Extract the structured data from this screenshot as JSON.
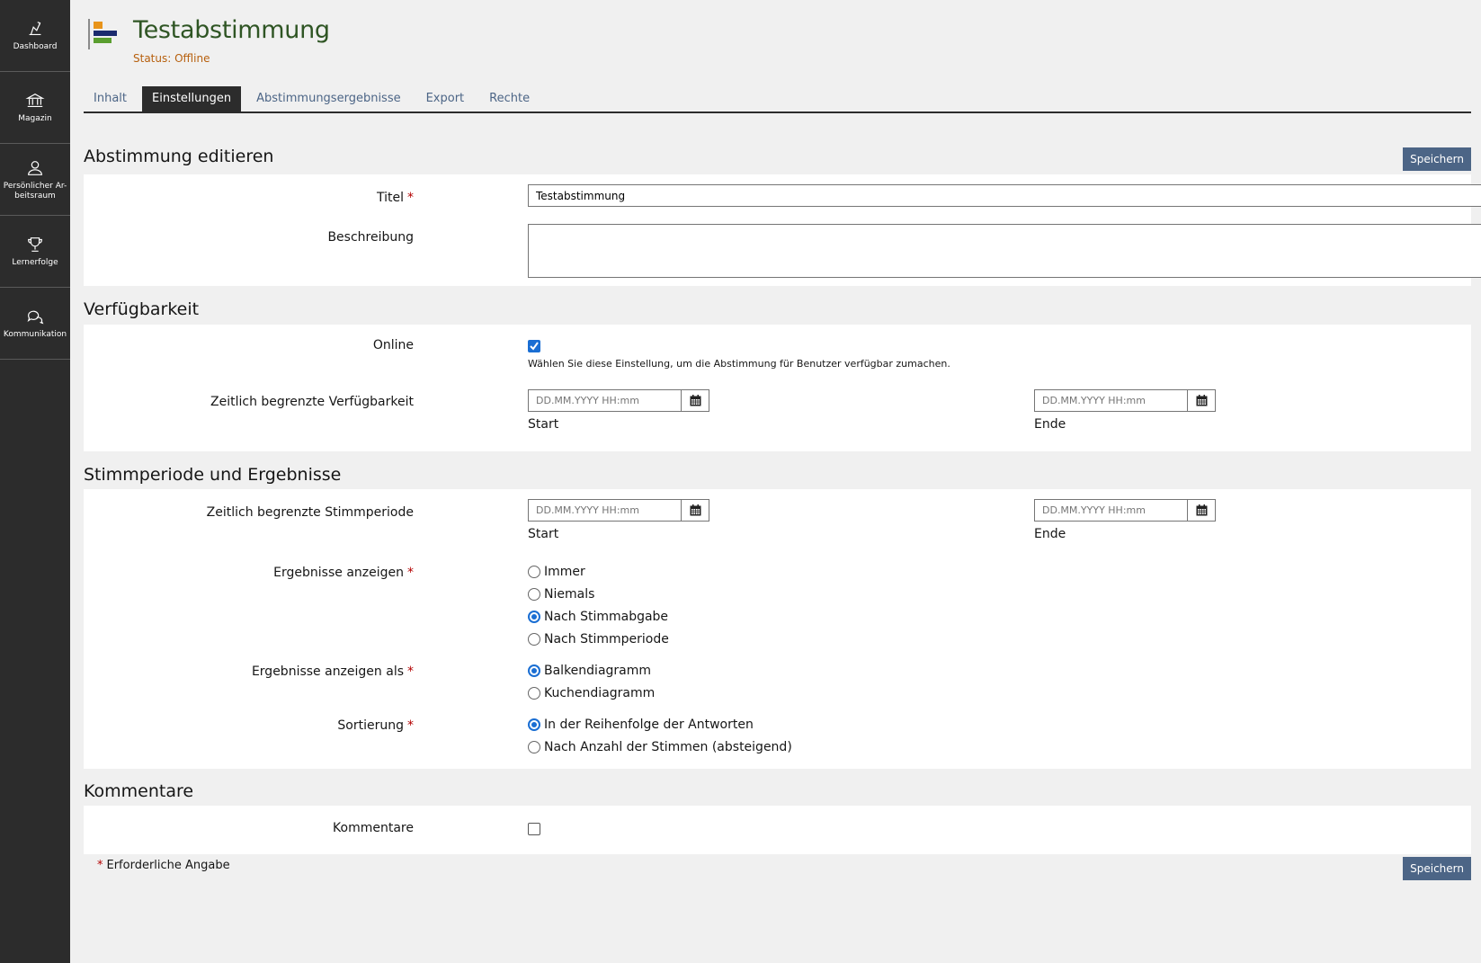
{
  "sidebar": {
    "items": [
      {
        "label": "Dashboard",
        "icon": "dashboard-icon"
      },
      {
        "label": "Magazin",
        "icon": "bank-icon"
      },
      {
        "label": "Persönlicher Ar-beitsraum",
        "icon": "user-icon"
      },
      {
        "label": "Lernerfolge",
        "icon": "trophy-icon"
      },
      {
        "label": "Kommunikation",
        "icon": "chat-icon"
      }
    ]
  },
  "header": {
    "title": "Testabstimmung",
    "status": "Status: Offline",
    "icon": "poll-icon",
    "icon_colors": [
      "#e8941a",
      "#1b2b6e",
      "#5a9e2f"
    ]
  },
  "tabs": [
    {
      "label": "Inhalt",
      "active": false
    },
    {
      "label": "Einstellungen",
      "active": true
    },
    {
      "label": "Abstimmungsergebnisse",
      "active": false
    },
    {
      "label": "Export",
      "active": false
    },
    {
      "label": "Rechte",
      "active": false
    }
  ],
  "form": {
    "save_label": "Speichern",
    "edit": {
      "title": "Abstimmung editieren",
      "titel_label": "Titel",
      "titel_value": "Testabstimmung",
      "beschreibung_label": "Beschreibung",
      "beschreibung_value": ""
    },
    "availability": {
      "title": "Verfügbarkeit",
      "online_label": "Online",
      "online_checked": true,
      "online_help": "Wählen Sie diese Einstellung, um die Abstimmung für Benutzer verfügbar zumachen.",
      "limited_label": "Zeitlich begrenzte Verfügbarkeit",
      "date_placeholder": "DD.MM.YYYY HH:mm",
      "start_label": "Start",
      "end_label": "Ende"
    },
    "voting": {
      "title": "Stimmperiode und Ergebnisse",
      "period_label": "Zeitlich begrenzte Stimmperiode",
      "date_placeholder": "DD.MM.YYYY HH:mm",
      "start_label": "Start",
      "end_label": "Ende",
      "show_results_label": "Ergebnisse anzeigen",
      "show_results_options": [
        {
          "label": "Immer",
          "selected": false
        },
        {
          "label": "Niemals",
          "selected": false
        },
        {
          "label": "Nach Stimmabgabe",
          "selected": true
        },
        {
          "label": "Nach Stimmperiode",
          "selected": false
        }
      ],
      "show_as_label": "Ergebnisse anzeigen als",
      "show_as_options": [
        {
          "label": "Balkendiagramm",
          "selected": true
        },
        {
          "label": "Kuchendiagramm",
          "selected": false
        }
      ],
      "sort_label": "Sortierung",
      "sort_options": [
        {
          "label": "In der Reihenfolge der Antworten",
          "selected": true
        },
        {
          "label": "Nach Anzahl der Stimmen (absteigend)",
          "selected": false
        }
      ]
    },
    "comments": {
      "title": "Kommentare",
      "label": "Kommentare",
      "checked": false
    },
    "required_marker": "*",
    "required_note": "Erforderliche Angabe"
  },
  "colors": {
    "sidebar_bg": "#2c2c2c",
    "title": "#2f5524",
    "status": "#b7600e",
    "button": "#4c6586",
    "radio_selected": "#1a6ed3",
    "required": "#b30000"
  }
}
